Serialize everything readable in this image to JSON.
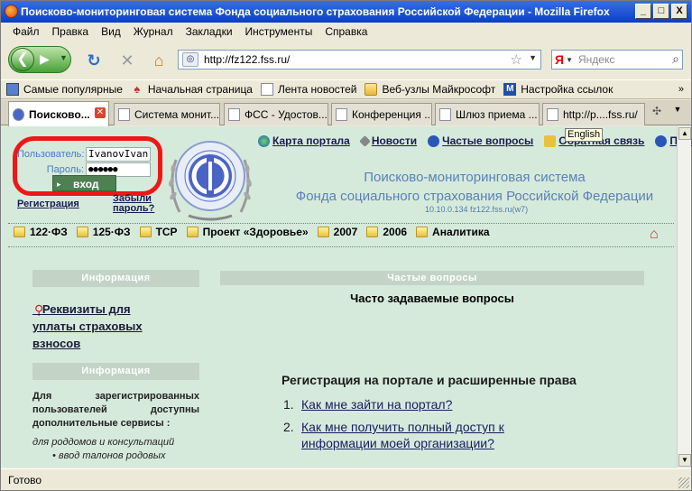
{
  "window": {
    "title": "Поисково-мониторинговая система Фонда социального страхования Российской Федерации - Mozilla Firefox",
    "min": "_",
    "max": "□",
    "close": "X"
  },
  "menu": [
    "Файл",
    "Правка",
    "Вид",
    "Журнал",
    "Закладки",
    "Инструменты",
    "Справка"
  ],
  "nav": {
    "url": "http://fz122.fss.ru/",
    "search_placeholder": "Яндекс",
    "search_engine": "Я"
  },
  "bookmarks": [
    "Самые популярные",
    "Начальная страница",
    "Лента новостей",
    "Веб-узлы Майкрософт",
    "Настройка ссылок"
  ],
  "tabs": [
    "Поисково...",
    "Система монит...",
    "ФСС - Удостов...",
    "Конференция ...",
    "Шлюз приема ...",
    "http://p....fss.ru/"
  ],
  "login": {
    "user_label": "Пользователь:",
    "user_value": "IvanovIvan",
    "pass_label": "Пароль:",
    "pass_value": "●●●●●●",
    "button": "вход",
    "register": "Регистрация",
    "forgot_line1": "Забыли",
    "forgot_line2": "пароль?"
  },
  "toplinks": [
    "Карта портала",
    "Новости",
    "Частые вопросы",
    "Обратная связь",
    "Пом"
  ],
  "tooltip": "English",
  "portal": {
    "title_line1": "Поисково-мониторинговая система",
    "title_line2": "Фонда социального страхования Российской Федерации",
    "version": "10.10.0.134  fz122.fss.ru(w7)"
  },
  "navstrip": [
    "122·ФЗ",
    "125·ФЗ",
    "ТСР",
    "Проект «Здоровье»",
    "2007",
    "2006",
    "Аналитика"
  ],
  "left": {
    "header1": "Информация",
    "link_line1": "Реквизиты для",
    "link_line2": "уплаты страховых",
    "link_line3": "взносов",
    "header2": "Информация",
    "para": "Для зарегистрированных пользователей доступны дополнительные сервисы :",
    "italic_line1": "для роддомов и консультаций",
    "italic_line2": "• ввод талонов родовых"
  },
  "right": {
    "header": "Частые вопросы",
    "title": "Часто задаваемые вопросы",
    "section": "Регистрация на портале и расширенные права",
    "q1_num": "1.",
    "q1": "Как мне зайти на портал?",
    "q2_num": "2.",
    "q2_line1": "Как мне получить полный доступ к",
    "q2_line2": "информации моей организации?"
  },
  "status": "Готово"
}
